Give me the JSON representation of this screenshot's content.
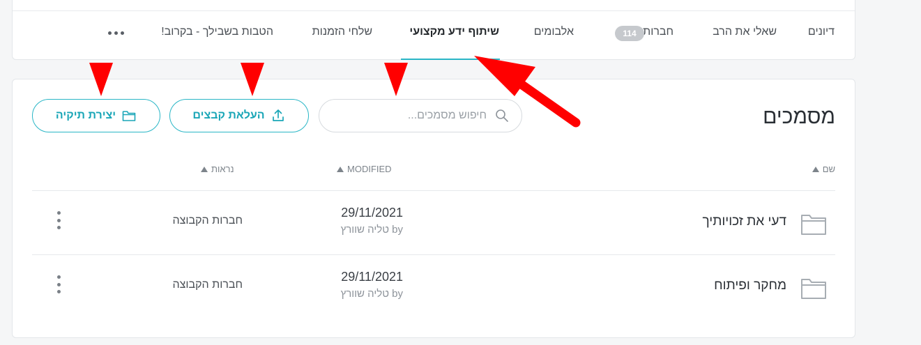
{
  "tabs": {
    "items": [
      {
        "label": "דיונים"
      },
      {
        "label": "שאלי את הרב"
      },
      {
        "label": "חברות",
        "badge": "114"
      },
      {
        "label": "אלבומים"
      },
      {
        "label": "שיתוף ידע מקצועי",
        "active": true
      },
      {
        "label": "שלחי הזמנות"
      },
      {
        "label": "הטבות בשבילך - בקרוב!"
      }
    ],
    "more_icon": "more-horizontal-icon"
  },
  "documents": {
    "title": "מסמכים",
    "search": {
      "placeholder": "חיפוש מסמכים...",
      "value": ""
    },
    "upload_label": "העלאת קבצים",
    "create_folder_label": "יצירת תיקיה",
    "columns": {
      "name": "שם",
      "modified": "MODIFIED",
      "viewed": "נראות"
    },
    "rows": [
      {
        "icon": "folder-icon",
        "name": "דעי את זכויותיך",
        "date": "29/11/2021",
        "by": "by טליה שוורץ",
        "viewed": "חברות הקבוצה"
      },
      {
        "icon": "folder-icon",
        "name": "מחקר ופיתוח",
        "date": "29/11/2021",
        "by": "by טליה שוורץ",
        "viewed": "חברות הקבוצה"
      }
    ]
  },
  "colors": {
    "accent": "#29b6c6",
    "annotation": "#ff0000"
  }
}
